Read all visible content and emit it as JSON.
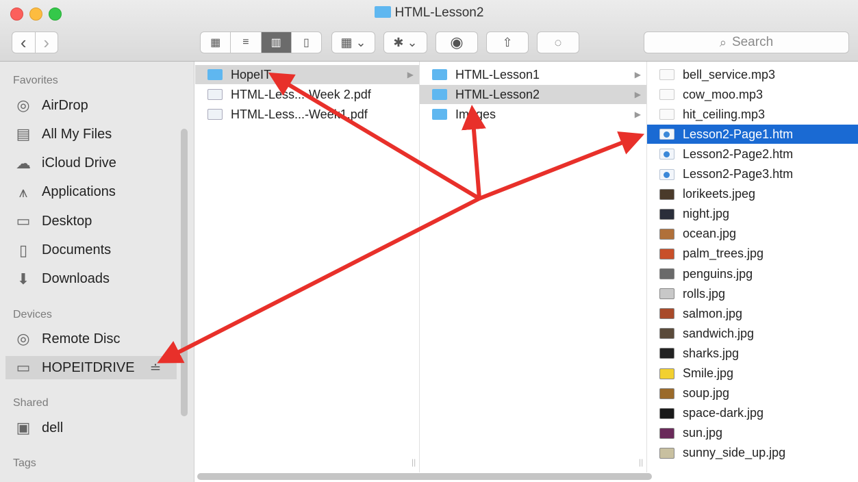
{
  "window": {
    "title": "HTML-Lesson2"
  },
  "toolbar": {
    "back": "‹",
    "forward": "›",
    "view_icon": "▦",
    "view_list": "≡",
    "view_columns": "▥",
    "view_cover": "▯",
    "arrange": "▦ ⌄",
    "action": "✱ ⌄",
    "quicklook": "◉",
    "share": "⇧",
    "tag": "◌",
    "search_placeholder": "Search"
  },
  "sidebar": {
    "favorites_header": "Favorites",
    "favorites": [
      {
        "label": "AirDrop",
        "icon": "◎"
      },
      {
        "label": "All My Files",
        "icon": "▤"
      },
      {
        "label": "iCloud Drive",
        "icon": "☁"
      },
      {
        "label": "Applications",
        "icon": "⩚"
      },
      {
        "label": "Desktop",
        "icon": "▭"
      },
      {
        "label": "Documents",
        "icon": "▯"
      },
      {
        "label": "Downloads",
        "icon": "⬇"
      }
    ],
    "devices_header": "Devices",
    "devices": [
      {
        "label": "Remote Disc",
        "icon": "◎"
      },
      {
        "label": "HOPEITDRIVE",
        "icon": "▭",
        "eject": "≐"
      }
    ],
    "shared_header": "Shared",
    "shared": [
      {
        "label": "dell",
        "icon": "▣"
      }
    ],
    "tags_header": "Tags"
  },
  "columns": {
    "col1": [
      {
        "label": "HopeIT",
        "type": "folder",
        "arrow": "▶"
      },
      {
        "label": "HTML-Less...-Week 2.pdf",
        "type": "pdf"
      },
      {
        "label": "HTML-Less...-Week1.pdf",
        "type": "pdf"
      }
    ],
    "col2": [
      {
        "label": "HTML-Lesson1",
        "type": "folder",
        "arrow": "▶"
      },
      {
        "label": "HTML-Lesson2",
        "type": "folder",
        "arrow": "▶"
      },
      {
        "label": "Images",
        "type": "folder",
        "arrow": "▶"
      }
    ],
    "col3": [
      {
        "label": "bell_service.mp3",
        "type": "audio"
      },
      {
        "label": "cow_moo.mp3",
        "type": "audio"
      },
      {
        "label": "hit_ceiling.mp3",
        "type": "audio"
      },
      {
        "label": "Lesson2-Page1.htm",
        "type": "htm"
      },
      {
        "label": "Lesson2-Page2.htm",
        "type": "htm"
      },
      {
        "label": "Lesson2-Page3.htm",
        "type": "htm"
      },
      {
        "label": "lorikeets.jpeg",
        "type": "img",
        "color": "#4a3a2a"
      },
      {
        "label": "night.jpg",
        "type": "img",
        "color": "#2a2e3a"
      },
      {
        "label": "ocean.jpg",
        "type": "img",
        "color": "#b0703a"
      },
      {
        "label": "palm_trees.jpg",
        "type": "img",
        "color": "#c8502a"
      },
      {
        "label": "penguins.jpg",
        "type": "img",
        "color": "#6a6a6a"
      },
      {
        "label": "rolls.jpg",
        "type": "img",
        "color": "#c8c8c8"
      },
      {
        "label": "salmon.jpg",
        "type": "img",
        "color": "#a84a2a"
      },
      {
        "label": "sandwich.jpg",
        "type": "img",
        "color": "#5a4a3a"
      },
      {
        "label": "sharks.jpg",
        "type": "img",
        "color": "#222222"
      },
      {
        "label": "Smile.jpg",
        "type": "img",
        "color": "#f2d030"
      },
      {
        "label": "soup.jpg",
        "type": "img",
        "color": "#9a6a2a"
      },
      {
        "label": "space-dark.jpg",
        "type": "img",
        "color": "#1a1a1a"
      },
      {
        "label": "sun.jpg",
        "type": "img",
        "color": "#6a2a5a"
      },
      {
        "label": "sunny_side_up.jpg",
        "type": "img",
        "color": "#c8c0a0"
      }
    ]
  },
  "colors": {
    "selection": "#1a6ad3",
    "annotation_arrow": "#e8302a",
    "folder": "#5fb7f0"
  }
}
